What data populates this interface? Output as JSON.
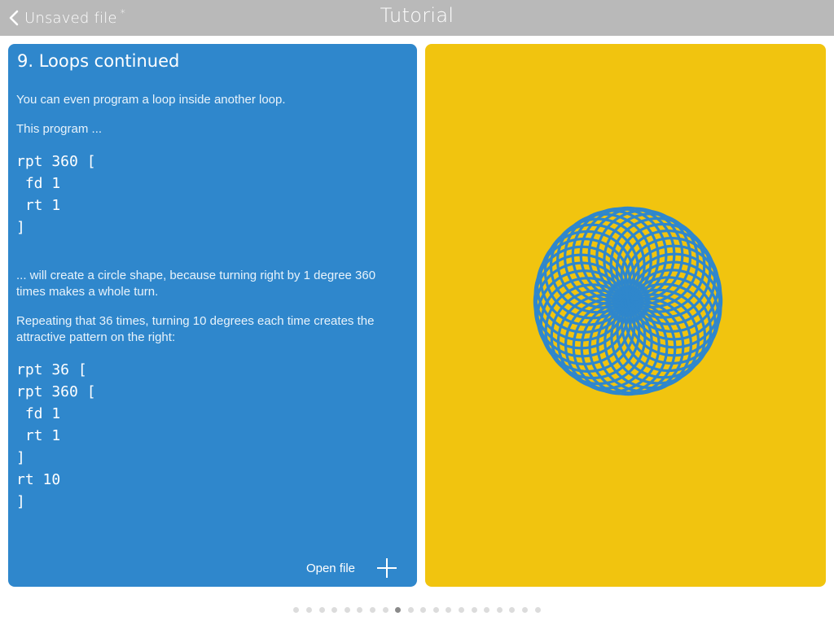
{
  "topbar": {
    "back_label": "Unsaved file",
    "unsaved_marker": "*",
    "title": "Tutorial"
  },
  "lesson": {
    "title": "9. Loops continued",
    "intro_1": "You can even program a loop inside another loop.",
    "intro_2": "This program ...",
    "code_1": [
      "rpt 360 [",
      " fd 1",
      " rt 1",
      "]"
    ],
    "explain_1": "... will create a circle shape, because turning right by 1 degree 360 times makes a whole turn.",
    "explain_2": "Repeating that 36 times, turning 10 degrees each time creates the attractive pattern on the right:",
    "code_2": [
      "rpt 36 [",
      "rpt 360 [",
      " fd 1",
      " rt 1",
      "]",
      "rt 10",
      "]"
    ]
  },
  "actions": {
    "open_file_label": "Open file",
    "add_icon": "plus-icon"
  },
  "drawing": {
    "background": "#f1c40f",
    "stroke": "#2f87cc",
    "outer_repeat": 36,
    "inner_repeat": 360,
    "step": 1,
    "inner_turn_deg": 1,
    "outer_turn_deg": 10
  },
  "pager": {
    "total": 20,
    "active_index": 8
  },
  "colors": {
    "topbar": "#b9b9b9",
    "lesson_panel": "#2f87cc",
    "canvas_panel": "#f1c40f"
  }
}
